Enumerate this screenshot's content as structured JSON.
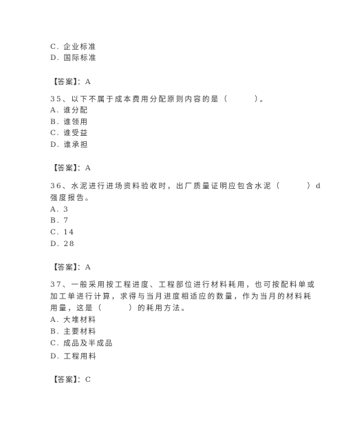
{
  "prev_question": {
    "options": [
      {
        "label": "C. 企业标准"
      },
      {
        "label": "D. 国际标准"
      }
    ],
    "answer": {
      "prefix_open": "【",
      "word": "答案",
      "prefix_close": "】",
      "sep": "：",
      "value": "A"
    }
  },
  "questions": [
    {
      "number": "35",
      "lines": [
        "35、以下不属于成本费用分配原则内容的是（　　　）。"
      ],
      "options": [
        "A. 谁分配",
        "B. 谁领用",
        "C. 谁受益",
        "D. 谁承担"
      ],
      "answer": {
        "prefix_open": "【",
        "word": "答案",
        "prefix_close": "】",
        "sep": "：",
        "value": "A"
      }
    },
    {
      "number": "36",
      "lines": [
        "36、水泥进行进场资料验收时，出厂质量证明应包含水泥（　　　）d",
        "强度报告。"
      ],
      "options": [
        "A. 3",
        "B. 7",
        "C. 14",
        "D. 28"
      ],
      "answer": {
        "prefix_open": "【",
        "word": "答案",
        "prefix_close": "】",
        "sep": "：",
        "value": "A"
      }
    },
    {
      "number": "37",
      "lines": [
        "37、一般采用按工程进度、工程部位进行材料耗用，也可按配料单或",
        "加工单进行计算，求得与当月进度相适应的数量，作为当月的材料耗",
        "用量，这是（　　　）的耗用方法。"
      ],
      "options": [
        "A. 大堆材料",
        "B. 主要材料",
        "C. 成品及半成品",
        "D. 工程用料"
      ],
      "answer": {
        "prefix_open": "【",
        "word": "答案",
        "prefix_close": "】",
        "sep": "：",
        "value": "C"
      }
    }
  ]
}
